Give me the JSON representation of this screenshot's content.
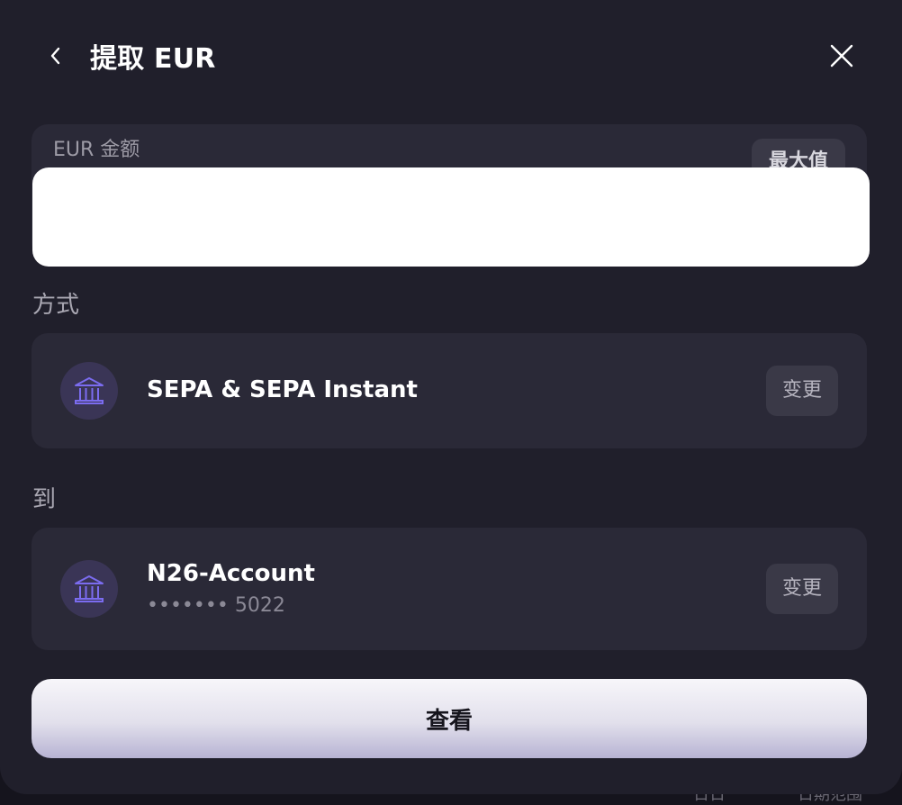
{
  "header": {
    "title": "提取 EUR"
  },
  "amount": {
    "label": "EUR 金额",
    "max_label": "最大值",
    "value": ""
  },
  "method": {
    "section_label": "方式",
    "name": "SEPA & SEPA Instant",
    "change_label": "变更",
    "icon": "bank-icon",
    "icon_color": "#7b6cf0"
  },
  "destination": {
    "section_label": "到",
    "account_name": "N26-Account",
    "account_number": "••••••• 5022",
    "change_label": "变更",
    "icon": "bank-icon"
  },
  "review_button": {
    "label": "查看"
  },
  "backdrop": {
    "text_left": "日日",
    "text_right": "日期范围"
  }
}
